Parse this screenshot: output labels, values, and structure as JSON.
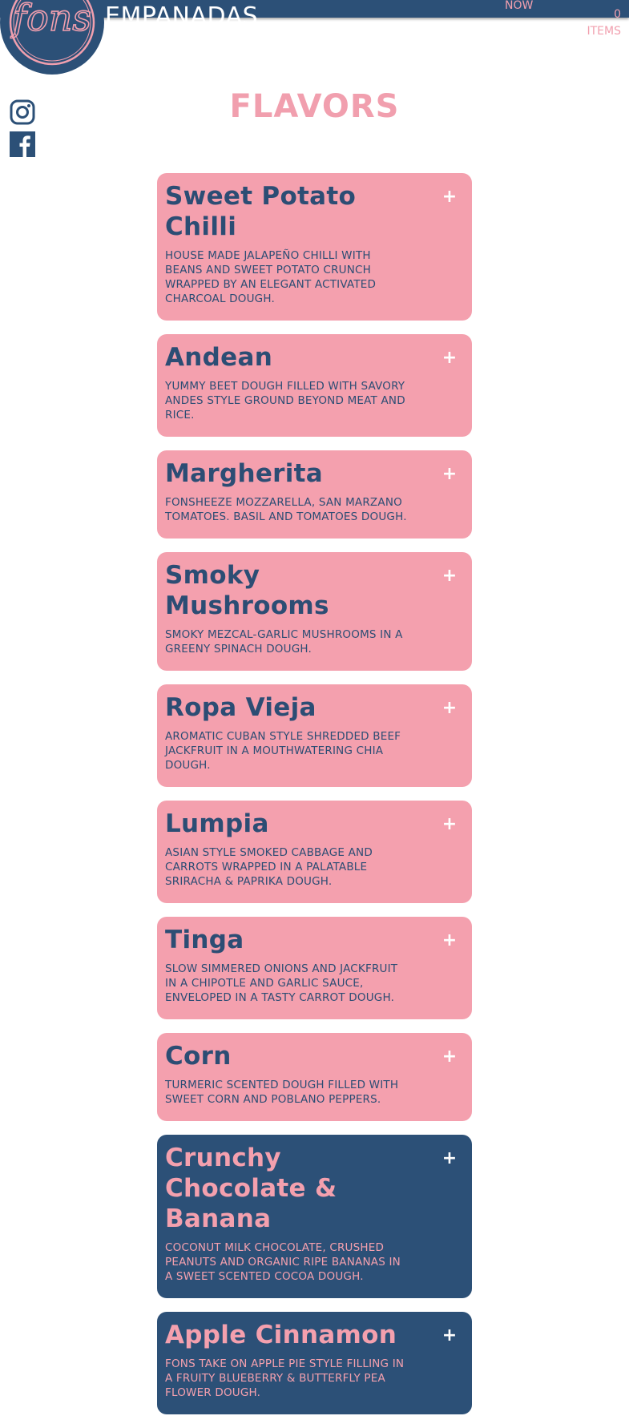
{
  "header": {
    "brand": "EMPANADAS",
    "order_now": "NOW",
    "cart_count": "0",
    "cart_label": "ITEMS",
    "logo_text": "fons",
    "logo_icon": "fons-logo",
    "colors": {
      "bar": "#2c5077",
      "accent": "#f19fae"
    }
  },
  "social": [
    {
      "icon": "instagram-icon"
    },
    {
      "icon": "facebook-icon"
    }
  ],
  "page": {
    "heading": "FLAVORS"
  },
  "menu": {
    "add_symbol": "+",
    "items": [
      {
        "title": "Sweet Potato Chilli",
        "description": "HOUSE MADE JALAPEÑO CHILLI WITH BEANS AND SWEET POTATO CRUNCH WRAPPED BY AN ELEGANT ACTIVATED CHARCOAL DOUGH.",
        "style": "pink"
      },
      {
        "title": "Andean",
        "description": "YUMMY BEET DOUGH FILLED WITH SAVORY ANDES STYLE GROUND BEYOND MEAT AND RICE.",
        "style": "pink"
      },
      {
        "title": "Margherita",
        "description": "FONSHEEZE MOZZARELLA, SAN MARZANO TOMATOES. BASIL AND TOMATOES DOUGH.",
        "style": "pink"
      },
      {
        "title": "Smoky Mushrooms",
        "description": "SMOKY MEZCAL-GARLIC MUSHROOMS IN A GREENY SPINACH DOUGH.",
        "style": "pink"
      },
      {
        "title": "Ropa Vieja",
        "description": "AROMATIC CUBAN STYLE SHREDDED BEEF JACKFRUIT IN A MOUTHWATERING CHIA DOUGH.",
        "style": "pink"
      },
      {
        "title": "Lumpia",
        "description": "ASIAN STYLE SMOKED CABBAGE AND CARROTS WRAPPED IN A PALATABLE SRIRACHA & PAPRIKA DOUGH.",
        "style": "pink"
      },
      {
        "title": "Tinga",
        "description": "SLOW SIMMERED ONIONS AND JACKFRUIT IN A CHIPOTLE AND GARLIC SAUCE, ENVELOPED IN A TASTY CARROT DOUGH.",
        "style": "pink"
      },
      {
        "title": "Corn",
        "description": "TURMERIC SCENTED DOUGH FILLED WITH SWEET CORN AND POBLANO PEPPERS.",
        "style": "pink"
      },
      {
        "title": "Crunchy Chocolate & Banana",
        "description": "COCONUT MILK CHOCOLATE, CRUSHED PEANUTS AND ORGANIC RIPE BANANAS IN A SWEET SCENTED COCOA DOUGH.",
        "style": "blue"
      },
      {
        "title": "Apple Cinnamon",
        "description": "FONS TAKE ON APPLE PIE STYLE FILLING IN A FRUITY BLUEBERRY & BUTTERFLY PEA FLOWER DOUGH.",
        "style": "blue"
      }
    ]
  }
}
